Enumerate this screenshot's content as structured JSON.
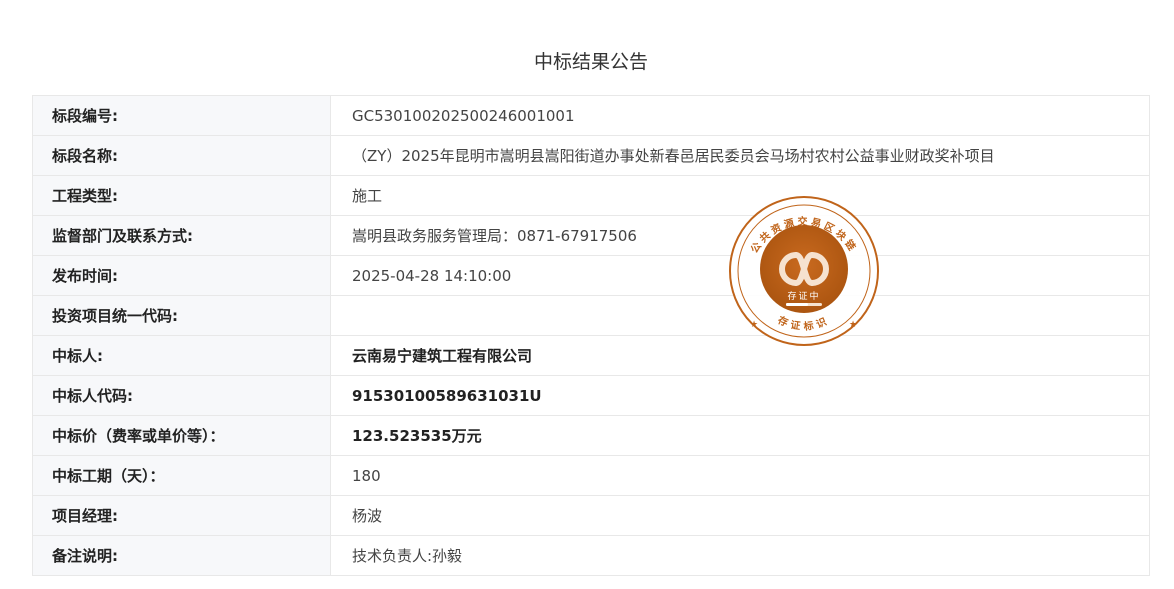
{
  "title": "中标结果公告",
  "rows": [
    {
      "label": "标段编号:",
      "value": "GC5301002025002460010​01"
    },
    {
      "label": "标段名称:",
      "value": "（ZY）2025年昆明市嵩明县嵩阳街道办事处新春邑居民委员会马场村农村公益事业财政奖补项目"
    },
    {
      "label": "工程类型:",
      "value": "施工"
    },
    {
      "label": "监督部门及联系方式:",
      "value": "嵩明县政务服务管理局：0871-67917506"
    },
    {
      "label": "发布时间:",
      "value": "2025-04-28 14:10:00"
    },
    {
      "label": "投资项目统一代码:",
      "value": ""
    },
    {
      "label": "中标人:",
      "value": "云南易宁建筑工程有限公司"
    },
    {
      "label": "中标人代码:",
      "value": "91530100589631031U"
    },
    {
      "label": "中标价（费率或单价等）：",
      "value": "123.523535万元"
    },
    {
      "label": "中标工期（天）：",
      "value": "180"
    },
    {
      "label": "项目经理:",
      "value": "杨波"
    },
    {
      "label": "备注说明:",
      "value": "技术负责人:孙毅"
    }
  ],
  "seal": {
    "outer_text": "公共资源交易区块链",
    "center_text": "存证中",
    "bottom_text": "存证标识",
    "color": "#c0641a"
  }
}
